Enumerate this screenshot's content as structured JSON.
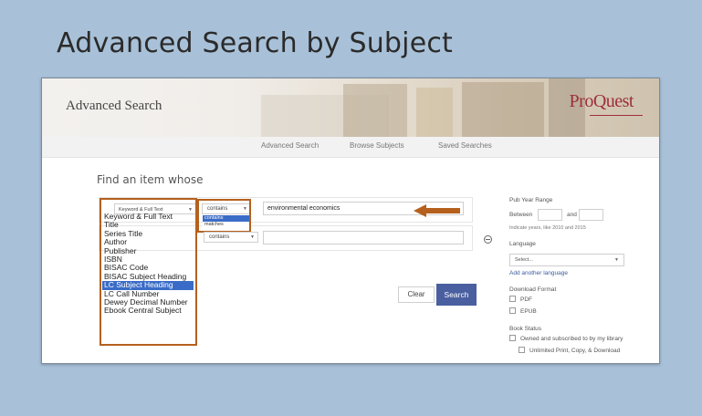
{
  "slide": {
    "title": "Advanced Search by Subject"
  },
  "banner": {
    "title": "Advanced Search",
    "logo": "ProQuest"
  },
  "nav": {
    "items": [
      "Advanced Search",
      "Browse Subjects",
      "Saved Searches"
    ]
  },
  "form": {
    "heading": "Find an item whose",
    "row1": {
      "field_selected": "Keyword & Full Text",
      "field_options": [
        "Keyword & Full Text",
        "Title",
        "Series Title",
        "Author",
        "Publisher",
        "ISBN",
        "BISAC Code",
        "BISAC Subject Heading",
        "LC Subject Heading",
        "LC Call Number",
        "Dewey Decimal Number",
        "Ebook Central Subject"
      ],
      "field_highlighted": "LC Subject Heading",
      "operator_selected": "contains",
      "operator_options": [
        "contains",
        "matches"
      ],
      "value": "environmental economics"
    },
    "row2": {
      "operator_selected": "contains",
      "value": ""
    },
    "clear_label": "Clear",
    "search_label": "Search"
  },
  "sidebar": {
    "pub_year_label": "Pub Year Range",
    "between_label": "Between",
    "and_label": "and",
    "year_hint": "Indicate years, like 2010 and 2015",
    "language_label": "Language",
    "language_placeholder": "Select...",
    "add_language": "Add another language",
    "download_label": "Download Format",
    "format_pdf": "PDF",
    "format_epub": "EPUB",
    "book_status_label": "Book Status",
    "status_owned": "Owned and subscribed to by my library",
    "status_unlimited": "Unlimited Print, Copy, & Download"
  },
  "colors": {
    "accent": "#b5601d",
    "search_button": "#4a5fa0",
    "highlight": "#3a6cc7",
    "logo": "#9c2f3a"
  }
}
